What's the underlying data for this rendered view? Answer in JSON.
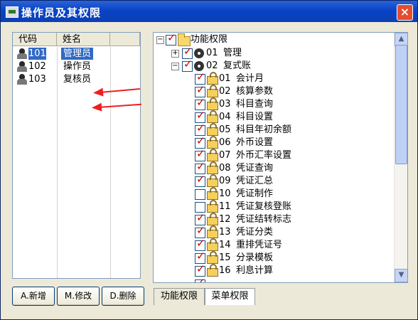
{
  "window": {
    "title": "操作员及其权限",
    "close": "×"
  },
  "users": {
    "headers": [
      "代码",
      "姓名"
    ],
    "rows": [
      {
        "code": "101",
        "name": "管理员",
        "selected": true
      },
      {
        "code": "102",
        "name": "操作员"
      },
      {
        "code": "103",
        "name": "复核员"
      }
    ]
  },
  "buttons": {
    "add": "A.新增",
    "edit": "M.修改",
    "delete": "D.删除"
  },
  "tree": {
    "root": "功能权限",
    "group1": {
      "code": "01",
      "name": "管理"
    },
    "group2": {
      "code": "02",
      "name": "复式账"
    },
    "items": [
      {
        "code": "01",
        "name": "会计月",
        "checked": true
      },
      {
        "code": "02",
        "name": "核算参数",
        "checked": true
      },
      {
        "code": "03",
        "name": "科目查询",
        "checked": true
      },
      {
        "code": "04",
        "name": "科目设置",
        "checked": true
      },
      {
        "code": "05",
        "name": "科目年初余额",
        "checked": true
      },
      {
        "code": "06",
        "name": "外币设置",
        "checked": true
      },
      {
        "code": "07",
        "name": "外币汇率设置",
        "checked": true
      },
      {
        "code": "08",
        "name": "凭证查询",
        "checked": true
      },
      {
        "code": "09",
        "name": "凭证汇总",
        "checked": true
      },
      {
        "code": "10",
        "name": "凭证制作",
        "checked": false
      },
      {
        "code": "11",
        "name": "凭证复核登账",
        "checked": false
      },
      {
        "code": "12",
        "name": "凭证结转标志",
        "checked": true
      },
      {
        "code": "13",
        "name": "凭证分类",
        "checked": true
      },
      {
        "code": "14",
        "name": "重排凭证号",
        "checked": true
      },
      {
        "code": "15",
        "name": "分录模板",
        "checked": true
      },
      {
        "code": "16",
        "name": "利息计算",
        "checked": true
      }
    ]
  },
  "tabs": [
    "功能权限",
    "菜单权限"
  ],
  "colors": {
    "title_bar": "#0a43c8",
    "selection": "#316ac5",
    "annotation_arrow": "#ef1f1f",
    "checkmark": "#d00000"
  }
}
